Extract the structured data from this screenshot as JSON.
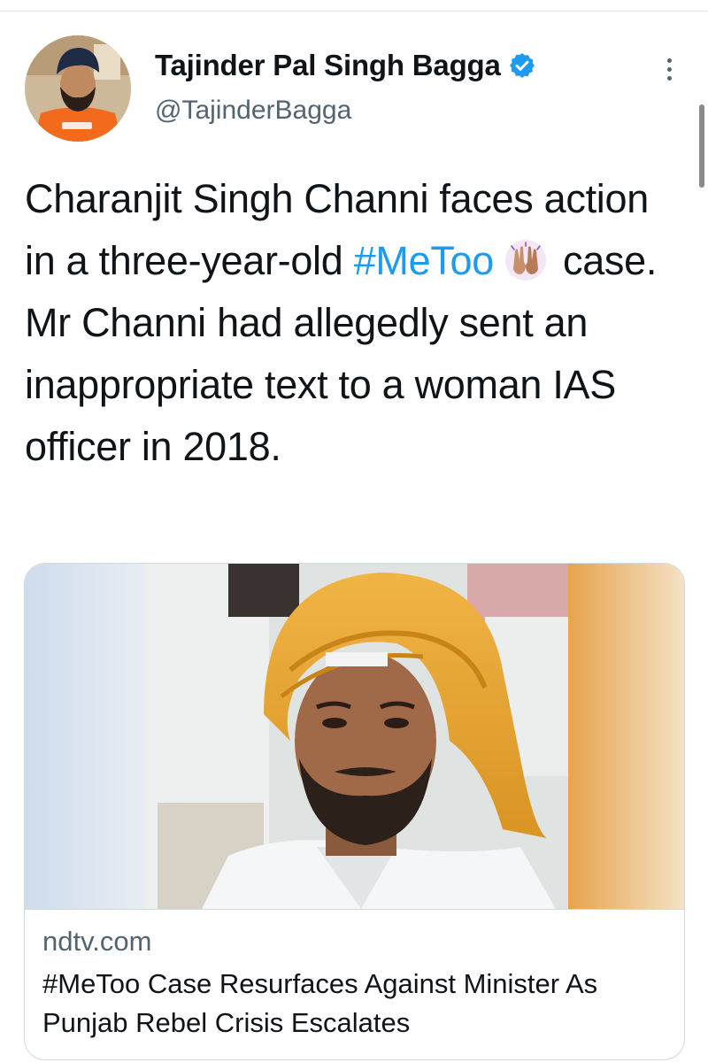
{
  "tweet": {
    "author": {
      "display_name": "Tajinder Pal Singh Bagga",
      "handle": "@TajinderBagga",
      "verified": true,
      "avatar_icon": "profile-photo"
    },
    "text": {
      "part1": "Charanjit Singh Channi faces action in a three-year-old ",
      "hashtag": "#MeToo",
      "emoji": "raising-hands-emoji",
      "part2": "case. Mr Channi had allegedly sent an inappropriate text to a woman IAS officer in 2018."
    },
    "link_card": {
      "domain": "ndtv.com",
      "title": "#MeToo Case Resurfaces Against Minister As Punjab Rebel Crisis Escalates",
      "image_icon": "article-photo"
    },
    "more_icon": "more-options-icon"
  },
  "colors": {
    "text": "#0f1419",
    "secondary": "#536471",
    "link": "#1d9bf0",
    "verified": "#1d9bf0",
    "border": "#cfd9de"
  }
}
